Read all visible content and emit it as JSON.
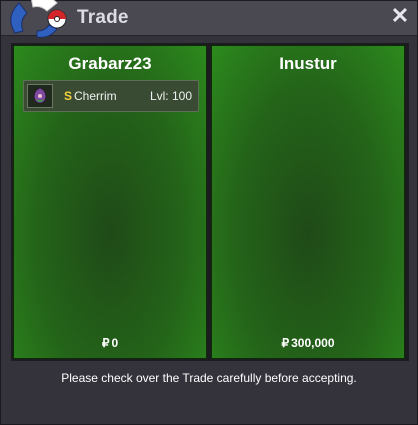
{
  "window": {
    "title": "Trade",
    "close_glyph": "✕"
  },
  "left_panel": {
    "player": "Grabarz23",
    "items": [
      {
        "icon": "cherrim-sprite-icon",
        "shiny_mark": "S",
        "name": "Cherrim",
        "level": "Lvl: 100"
      }
    ],
    "money_symbol": "₽",
    "money": "0"
  },
  "right_panel": {
    "player": "Inustur",
    "items": [],
    "money_symbol": "₽",
    "money": "300,000"
  },
  "footer": {
    "message": "Please check over the Trade carefully before accepting."
  },
  "colors": {
    "panel_green": "#246419",
    "window_bg": "#34333c",
    "shiny": "#f2d23a"
  }
}
